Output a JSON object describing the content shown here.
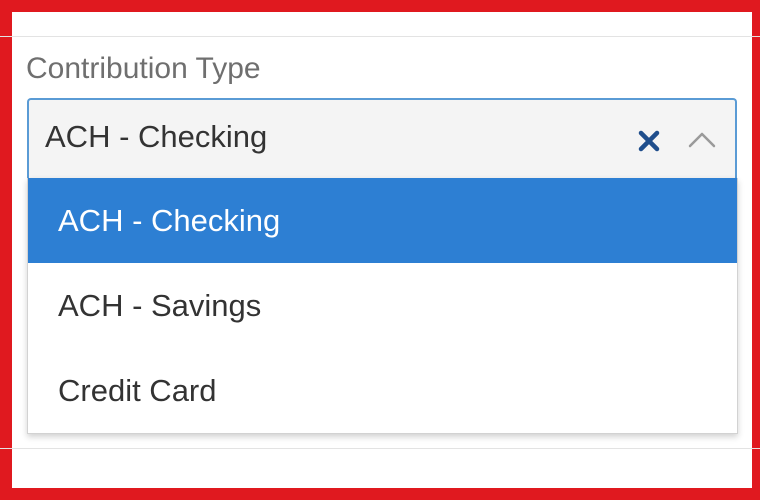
{
  "field": {
    "label": "Contribution Type",
    "selected_value": "ACH - Checking",
    "clear_icon": "close-x-icon",
    "toggle_icon": "chevron-up-icon",
    "expanded": true
  },
  "dropdown": {
    "options": [
      {
        "label": "ACH - Checking",
        "selected": true
      },
      {
        "label": "ACH - Savings",
        "selected": false
      },
      {
        "label": "Credit Card",
        "selected": false
      }
    ]
  },
  "colors": {
    "highlight_border": "#e0191f",
    "selected_option_bg": "#2d7fd3",
    "selected_option_text": "#ffffff",
    "select_border": "#5a9bd5",
    "clear_icon_color": "#1f4e8c",
    "chevron_color": "#9a9a9a",
    "label_color": "#6f6f6f",
    "text_color": "#333333"
  }
}
